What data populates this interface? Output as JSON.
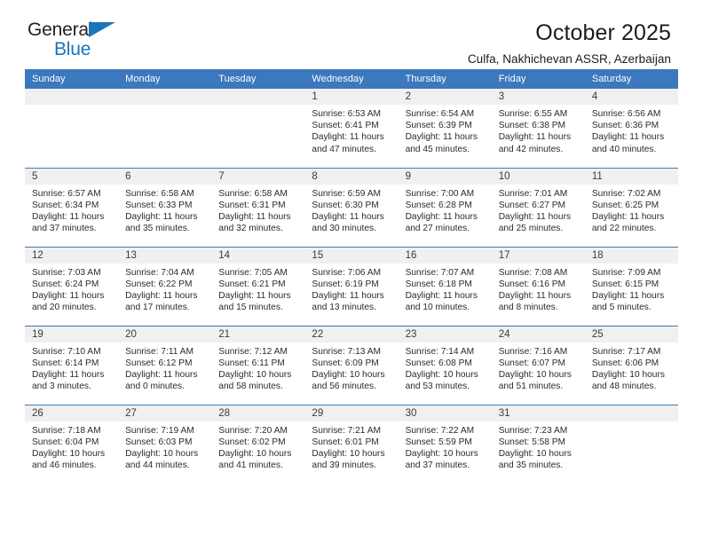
{
  "brand": {
    "line1": "General",
    "line2": "Blue",
    "accent_color": "#1b75bb",
    "text_color": "#231f20"
  },
  "header": {
    "title": "October 2025",
    "subtitle": "Culfa, Nakhichevan ASSR, Azerbaijan"
  },
  "theme": {
    "header_blue": "#3b78bd",
    "daynum_band": "#f0f0f0",
    "cell_background": "#ffffff",
    "text": "#2b2b2b"
  },
  "weekdays": [
    "Sunday",
    "Monday",
    "Tuesday",
    "Wednesday",
    "Thursday",
    "Friday",
    "Saturday"
  ],
  "weeks": [
    [
      {
        "day": "",
        "sunrise": "",
        "sunset": "",
        "daylight1": "",
        "daylight2": ""
      },
      {
        "day": "",
        "sunrise": "",
        "sunset": "",
        "daylight1": "",
        "daylight2": ""
      },
      {
        "day": "",
        "sunrise": "",
        "sunset": "",
        "daylight1": "",
        "daylight2": ""
      },
      {
        "day": "1",
        "sunrise": "Sunrise: 6:53 AM",
        "sunset": "Sunset: 6:41 PM",
        "daylight1": "Daylight: 11 hours",
        "daylight2": "and 47 minutes."
      },
      {
        "day": "2",
        "sunrise": "Sunrise: 6:54 AM",
        "sunset": "Sunset: 6:39 PM",
        "daylight1": "Daylight: 11 hours",
        "daylight2": "and 45 minutes."
      },
      {
        "day": "3",
        "sunrise": "Sunrise: 6:55 AM",
        "sunset": "Sunset: 6:38 PM",
        "daylight1": "Daylight: 11 hours",
        "daylight2": "and 42 minutes."
      },
      {
        "day": "4",
        "sunrise": "Sunrise: 6:56 AM",
        "sunset": "Sunset: 6:36 PM",
        "daylight1": "Daylight: 11 hours",
        "daylight2": "and 40 minutes."
      }
    ],
    [
      {
        "day": "5",
        "sunrise": "Sunrise: 6:57 AM",
        "sunset": "Sunset: 6:34 PM",
        "daylight1": "Daylight: 11 hours",
        "daylight2": "and 37 minutes."
      },
      {
        "day": "6",
        "sunrise": "Sunrise: 6:58 AM",
        "sunset": "Sunset: 6:33 PM",
        "daylight1": "Daylight: 11 hours",
        "daylight2": "and 35 minutes."
      },
      {
        "day": "7",
        "sunrise": "Sunrise: 6:58 AM",
        "sunset": "Sunset: 6:31 PM",
        "daylight1": "Daylight: 11 hours",
        "daylight2": "and 32 minutes."
      },
      {
        "day": "8",
        "sunrise": "Sunrise: 6:59 AM",
        "sunset": "Sunset: 6:30 PM",
        "daylight1": "Daylight: 11 hours",
        "daylight2": "and 30 minutes."
      },
      {
        "day": "9",
        "sunrise": "Sunrise: 7:00 AM",
        "sunset": "Sunset: 6:28 PM",
        "daylight1": "Daylight: 11 hours",
        "daylight2": "and 27 minutes."
      },
      {
        "day": "10",
        "sunrise": "Sunrise: 7:01 AM",
        "sunset": "Sunset: 6:27 PM",
        "daylight1": "Daylight: 11 hours",
        "daylight2": "and 25 minutes."
      },
      {
        "day": "11",
        "sunrise": "Sunrise: 7:02 AM",
        "sunset": "Sunset: 6:25 PM",
        "daylight1": "Daylight: 11 hours",
        "daylight2": "and 22 minutes."
      }
    ],
    [
      {
        "day": "12",
        "sunrise": "Sunrise: 7:03 AM",
        "sunset": "Sunset: 6:24 PM",
        "daylight1": "Daylight: 11 hours",
        "daylight2": "and 20 minutes."
      },
      {
        "day": "13",
        "sunrise": "Sunrise: 7:04 AM",
        "sunset": "Sunset: 6:22 PM",
        "daylight1": "Daylight: 11 hours",
        "daylight2": "and 17 minutes."
      },
      {
        "day": "14",
        "sunrise": "Sunrise: 7:05 AM",
        "sunset": "Sunset: 6:21 PM",
        "daylight1": "Daylight: 11 hours",
        "daylight2": "and 15 minutes."
      },
      {
        "day": "15",
        "sunrise": "Sunrise: 7:06 AM",
        "sunset": "Sunset: 6:19 PM",
        "daylight1": "Daylight: 11 hours",
        "daylight2": "and 13 minutes."
      },
      {
        "day": "16",
        "sunrise": "Sunrise: 7:07 AM",
        "sunset": "Sunset: 6:18 PM",
        "daylight1": "Daylight: 11 hours",
        "daylight2": "and 10 minutes."
      },
      {
        "day": "17",
        "sunrise": "Sunrise: 7:08 AM",
        "sunset": "Sunset: 6:16 PM",
        "daylight1": "Daylight: 11 hours",
        "daylight2": "and 8 minutes."
      },
      {
        "day": "18",
        "sunrise": "Sunrise: 7:09 AM",
        "sunset": "Sunset: 6:15 PM",
        "daylight1": "Daylight: 11 hours",
        "daylight2": "and 5 minutes."
      }
    ],
    [
      {
        "day": "19",
        "sunrise": "Sunrise: 7:10 AM",
        "sunset": "Sunset: 6:14 PM",
        "daylight1": "Daylight: 11 hours",
        "daylight2": "and 3 minutes."
      },
      {
        "day": "20",
        "sunrise": "Sunrise: 7:11 AM",
        "sunset": "Sunset: 6:12 PM",
        "daylight1": "Daylight: 11 hours",
        "daylight2": "and 0 minutes."
      },
      {
        "day": "21",
        "sunrise": "Sunrise: 7:12 AM",
        "sunset": "Sunset: 6:11 PM",
        "daylight1": "Daylight: 10 hours",
        "daylight2": "and 58 minutes."
      },
      {
        "day": "22",
        "sunrise": "Sunrise: 7:13 AM",
        "sunset": "Sunset: 6:09 PM",
        "daylight1": "Daylight: 10 hours",
        "daylight2": "and 56 minutes."
      },
      {
        "day": "23",
        "sunrise": "Sunrise: 7:14 AM",
        "sunset": "Sunset: 6:08 PM",
        "daylight1": "Daylight: 10 hours",
        "daylight2": "and 53 minutes."
      },
      {
        "day": "24",
        "sunrise": "Sunrise: 7:16 AM",
        "sunset": "Sunset: 6:07 PM",
        "daylight1": "Daylight: 10 hours",
        "daylight2": "and 51 minutes."
      },
      {
        "day": "25",
        "sunrise": "Sunrise: 7:17 AM",
        "sunset": "Sunset: 6:06 PM",
        "daylight1": "Daylight: 10 hours",
        "daylight2": "and 48 minutes."
      }
    ],
    [
      {
        "day": "26",
        "sunrise": "Sunrise: 7:18 AM",
        "sunset": "Sunset: 6:04 PM",
        "daylight1": "Daylight: 10 hours",
        "daylight2": "and 46 minutes."
      },
      {
        "day": "27",
        "sunrise": "Sunrise: 7:19 AM",
        "sunset": "Sunset: 6:03 PM",
        "daylight1": "Daylight: 10 hours",
        "daylight2": "and 44 minutes."
      },
      {
        "day": "28",
        "sunrise": "Sunrise: 7:20 AM",
        "sunset": "Sunset: 6:02 PM",
        "daylight1": "Daylight: 10 hours",
        "daylight2": "and 41 minutes."
      },
      {
        "day": "29",
        "sunrise": "Sunrise: 7:21 AM",
        "sunset": "Sunset: 6:01 PM",
        "daylight1": "Daylight: 10 hours",
        "daylight2": "and 39 minutes."
      },
      {
        "day": "30",
        "sunrise": "Sunrise: 7:22 AM",
        "sunset": "Sunset: 5:59 PM",
        "daylight1": "Daylight: 10 hours",
        "daylight2": "and 37 minutes."
      },
      {
        "day": "31",
        "sunrise": "Sunrise: 7:23 AM",
        "sunset": "Sunset: 5:58 PM",
        "daylight1": "Daylight: 10 hours",
        "daylight2": "and 35 minutes."
      },
      {
        "day": "",
        "sunrise": "",
        "sunset": "",
        "daylight1": "",
        "daylight2": ""
      }
    ]
  ]
}
